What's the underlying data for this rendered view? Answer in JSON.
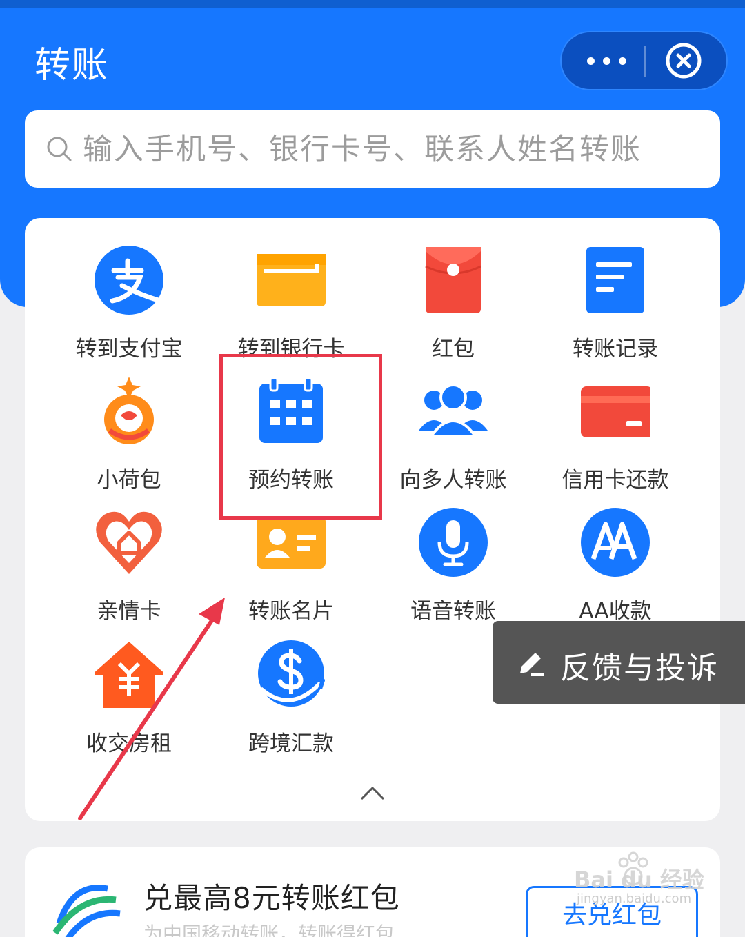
{
  "header": {
    "title": "转账"
  },
  "search": {
    "placeholder": "输入手机号、银行卡号、联系人姓名转账"
  },
  "grid": {
    "items": [
      {
        "label": "转到支付宝",
        "icon": "alipay-icon"
      },
      {
        "label": "转到银行卡",
        "icon": "bank-card-icon"
      },
      {
        "label": "红包",
        "icon": "red-envelope-icon"
      },
      {
        "label": "转账记录",
        "icon": "records-icon"
      },
      {
        "label": "小荷包",
        "icon": "pouch-icon"
      },
      {
        "label": "预约转账",
        "icon": "calendar-icon"
      },
      {
        "label": "向多人转账",
        "icon": "group-icon"
      },
      {
        "label": "信用卡还款",
        "icon": "credit-card-icon"
      },
      {
        "label": "亲情卡",
        "icon": "family-card-icon"
      },
      {
        "label": "转账名片",
        "icon": "business-card-icon"
      },
      {
        "label": "语音转账",
        "icon": "microphone-icon"
      },
      {
        "label": "AA收款",
        "icon": "aa-icon"
      },
      {
        "label": "收交房租",
        "icon": "rent-house-icon"
      },
      {
        "label": "跨境汇款",
        "icon": "cross-border-remit-icon"
      }
    ]
  },
  "feedback": {
    "label": "反馈与投诉"
  },
  "promo": {
    "title": "兑最高8元转账红包",
    "subtitle": "为中国移动转账，转账得红包",
    "button": "去兑红包"
  },
  "watermark": {
    "text": "Bai du 经验",
    "sub": "jingyan.baidu.com"
  },
  "colors": {
    "primary": "#1677ff",
    "highlight": "#e8384a"
  }
}
